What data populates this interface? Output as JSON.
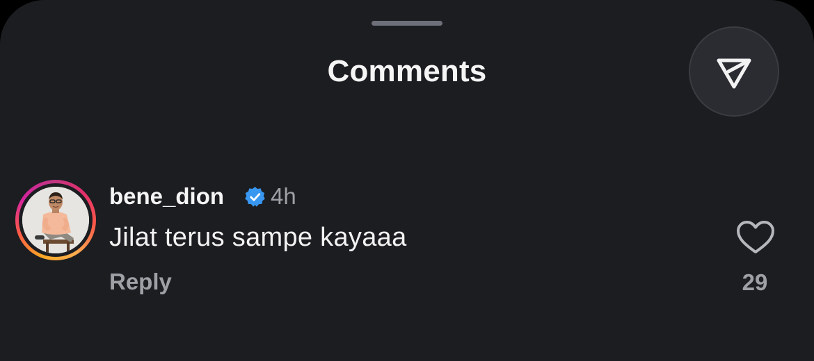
{
  "sheet": {
    "title": "Comments",
    "share_icon": "paper-plane-send-icon"
  },
  "comment": {
    "username": "bene_dion",
    "verified": true,
    "verified_icon": "verified-badge-icon",
    "timestamp": "4h",
    "text": "Jilat terus sampe kayaaa",
    "reply_label": "Reply",
    "like_icon": "heart-outline-icon",
    "like_count": "29"
  },
  "colors": {
    "background": "#1c1d21",
    "text_primary": "#f5f5f5",
    "text_secondary": "#9ea0a6",
    "verified_blue": "#3897f0"
  }
}
